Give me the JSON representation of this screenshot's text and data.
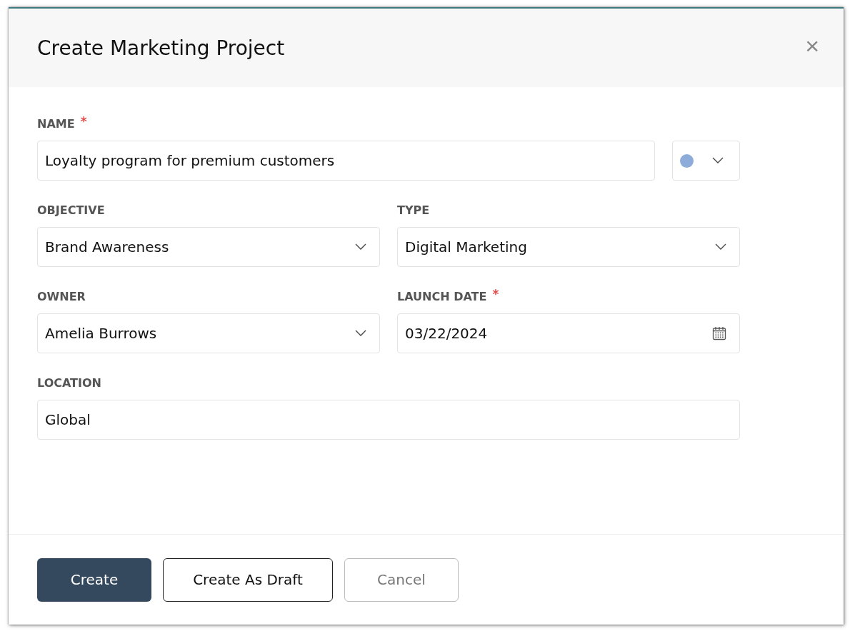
{
  "dialog": {
    "title": "Create Marketing Project",
    "close": "×"
  },
  "rows": [
    [
      {
        "kind": "text",
        "label": "NAME",
        "required_mark": "*",
        "value": "Loyalty program for premium customers"
      },
      {
        "kind": "color",
        "color": "#8eacd9"
      }
    ],
    [
      {
        "kind": "select",
        "label": "OBJECTIVE",
        "value": "Brand Awareness"
      },
      {
        "kind": "select",
        "label": "TYPE",
        "value": "Digital Marketing"
      }
    ],
    [
      {
        "kind": "select",
        "label": "OWNER",
        "value": "Amelia Burrows"
      },
      {
        "kind": "date",
        "label": "LAUNCH DATE",
        "required_mark": "*",
        "value": "03/22/2024"
      }
    ],
    [
      {
        "kind": "text",
        "label": "LOCATION",
        "value": "Global"
      }
    ]
  ],
  "buttons": [
    {
      "kind": "primary",
      "label": "Create"
    },
    {
      "kind": "secondary",
      "label": "Create As Draft"
    },
    {
      "kind": "tertiary",
      "label": "Cancel"
    }
  ]
}
